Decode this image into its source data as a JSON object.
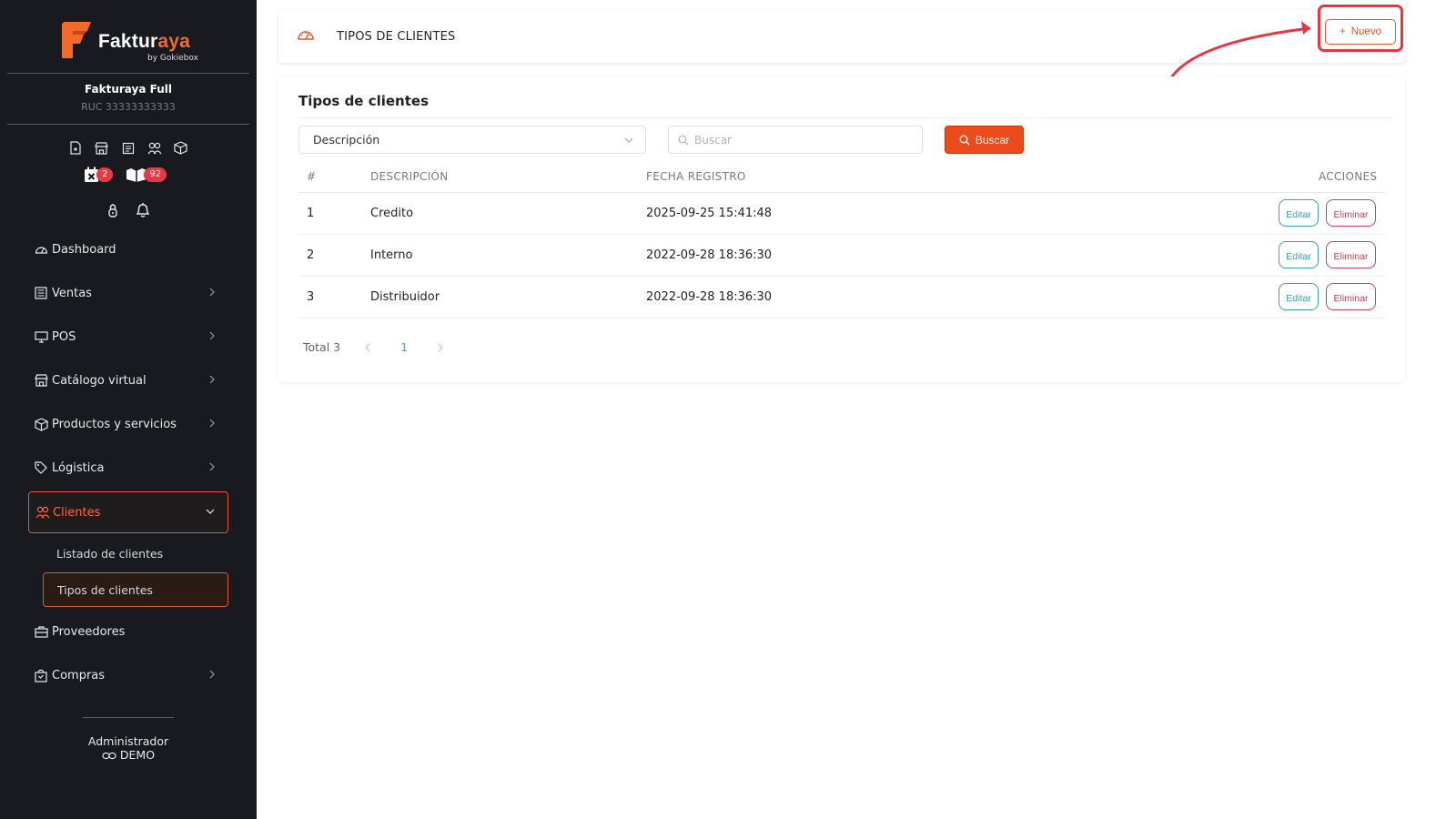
{
  "sidebar": {
    "brand": {
      "name": "Faktur",
      "name_accent": "aya",
      "byline": "by Gokiebox"
    },
    "company": {
      "name": "Fakturaya Full",
      "ruc": "RUC 33333333333"
    },
    "quick_icons": [
      "document-add-icon",
      "store-icon",
      "receipt-icon",
      "users-icon",
      "box-icon"
    ],
    "badges": [
      {
        "icon": "calendar-x-icon",
        "count": "2"
      },
      {
        "icon": "boxes-icon",
        "count": "92"
      }
    ],
    "utility_icons": [
      "lock-icon",
      "bell-icon"
    ],
    "nav": [
      {
        "label": "Dashboard",
        "icon": "dashboard-icon",
        "has_submenu": false
      },
      {
        "label": "Ventas",
        "icon": "sales-icon",
        "has_submenu": true
      },
      {
        "label": "POS",
        "icon": "monitor-icon",
        "has_submenu": true
      },
      {
        "label": "Catálogo virtual",
        "icon": "store-icon",
        "has_submenu": true
      },
      {
        "label": "Productos y servicios",
        "icon": "box-icon",
        "has_submenu": true
      },
      {
        "label": "Lógistica",
        "icon": "tag-icon",
        "has_submenu": true
      },
      {
        "label": "Clientes",
        "icon": "users-icon",
        "has_submenu": true,
        "active": true
      },
      {
        "label": "Proveedores",
        "icon": "briefcase-icon",
        "has_submenu": false
      },
      {
        "label": "Compras",
        "icon": "shopping-bag-icon",
        "has_submenu": true
      }
    ],
    "submenu": [
      {
        "label": "Listado de clientes"
      },
      {
        "label": "Tipos de clientes",
        "active": true
      }
    ],
    "user": {
      "role": "Administrador",
      "name": "DEMO"
    }
  },
  "header": {
    "title": "TIPOS DE CLIENTES",
    "new_button": "Nuevo",
    "accent": "#e4572e",
    "highlight_color": "#ee3340"
  },
  "content": {
    "title": "Tipos de clientes",
    "filter": {
      "selected": "Descripción"
    },
    "search": {
      "placeholder": "Buscar",
      "value": "",
      "button": "Buscar"
    },
    "table": {
      "columns": [
        "#",
        "DESCRIPCIÓN",
        "FECHA REGISTRO",
        "ACCIONES"
      ],
      "rows": [
        {
          "num": "1",
          "descripcion": "Credito",
          "fecha": "2025-09-25 15:41:48"
        },
        {
          "num": "2",
          "descripcion": "Interno",
          "fecha": "2022-09-28 18:36:30"
        },
        {
          "num": "3",
          "descripcion": "Distribuidor",
          "fecha": "2022-09-28 18:36:30"
        }
      ],
      "actions": {
        "edit": "Editar",
        "delete": "Eliminar"
      }
    },
    "pagination": {
      "total": "Total 3",
      "current_page": "1"
    }
  }
}
